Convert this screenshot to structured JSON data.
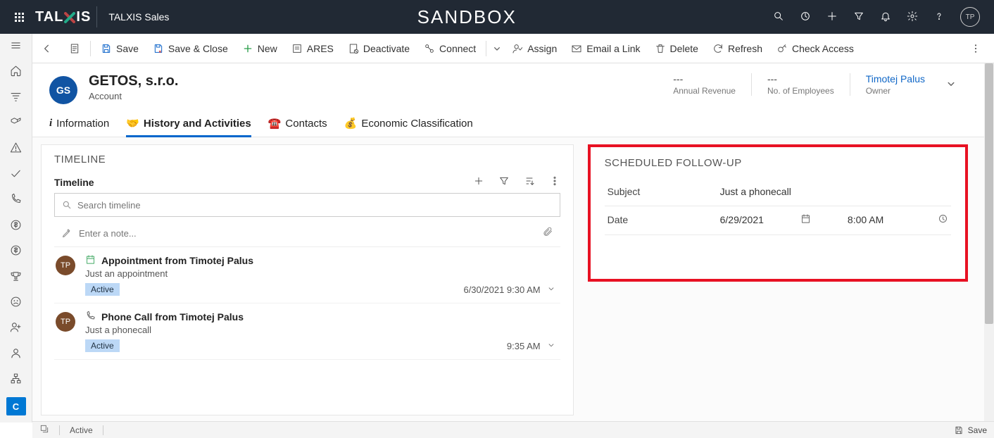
{
  "topnav": {
    "brand": "TALXIS",
    "app_name": "TALXIS Sales",
    "center_text": "SANDBOX",
    "avatar_initials": "TP"
  },
  "commandbar": {
    "save": "Save",
    "save_close": "Save & Close",
    "new": "New",
    "ares": "ARES",
    "deactivate": "Deactivate",
    "connect": "Connect",
    "assign": "Assign",
    "email_link": "Email a Link",
    "delete": "Delete",
    "refresh": "Refresh",
    "check_access": "Check Access"
  },
  "record": {
    "initials": "GS",
    "title": "GETOS, s.r.o.",
    "subtitle": "Account"
  },
  "header_fields": {
    "annual_revenue": {
      "value": "---",
      "label": "Annual Revenue"
    },
    "num_employees": {
      "value": "---",
      "label": "No. of Employees"
    },
    "owner": {
      "value": "Timotej Palus",
      "label": "Owner"
    }
  },
  "tabs": {
    "info": "Information",
    "history": "History and Activities",
    "contacts": "Contacts",
    "econ": "Economic Classification"
  },
  "timeline": {
    "panel_title": "TIMELINE",
    "sub_label": "Timeline",
    "search_placeholder": "Search timeline",
    "note_placeholder": "Enter a note...",
    "items": [
      {
        "avatar": "TP",
        "title": "Appointment from Timotej Palus",
        "desc": "Just an appointment",
        "status": "Active",
        "time": "6/30/2021 9:30 AM",
        "icon": "calendar"
      },
      {
        "avatar": "TP",
        "title": "Phone Call from Timotej Palus",
        "desc": "Just a phonecall",
        "status": "Active",
        "time": "9:35 AM",
        "icon": "phone"
      }
    ]
  },
  "followup": {
    "panel_title": "SCHEDULED FOLLOW-UP",
    "subject_label": "Subject",
    "subject_value": "Just a phonecall",
    "date_label": "Date",
    "date_value": "6/29/2021",
    "time_value": "8:00 AM"
  },
  "footer": {
    "status": "Active",
    "save": "Save"
  },
  "leftrail": {
    "bottom_letter": "C"
  }
}
